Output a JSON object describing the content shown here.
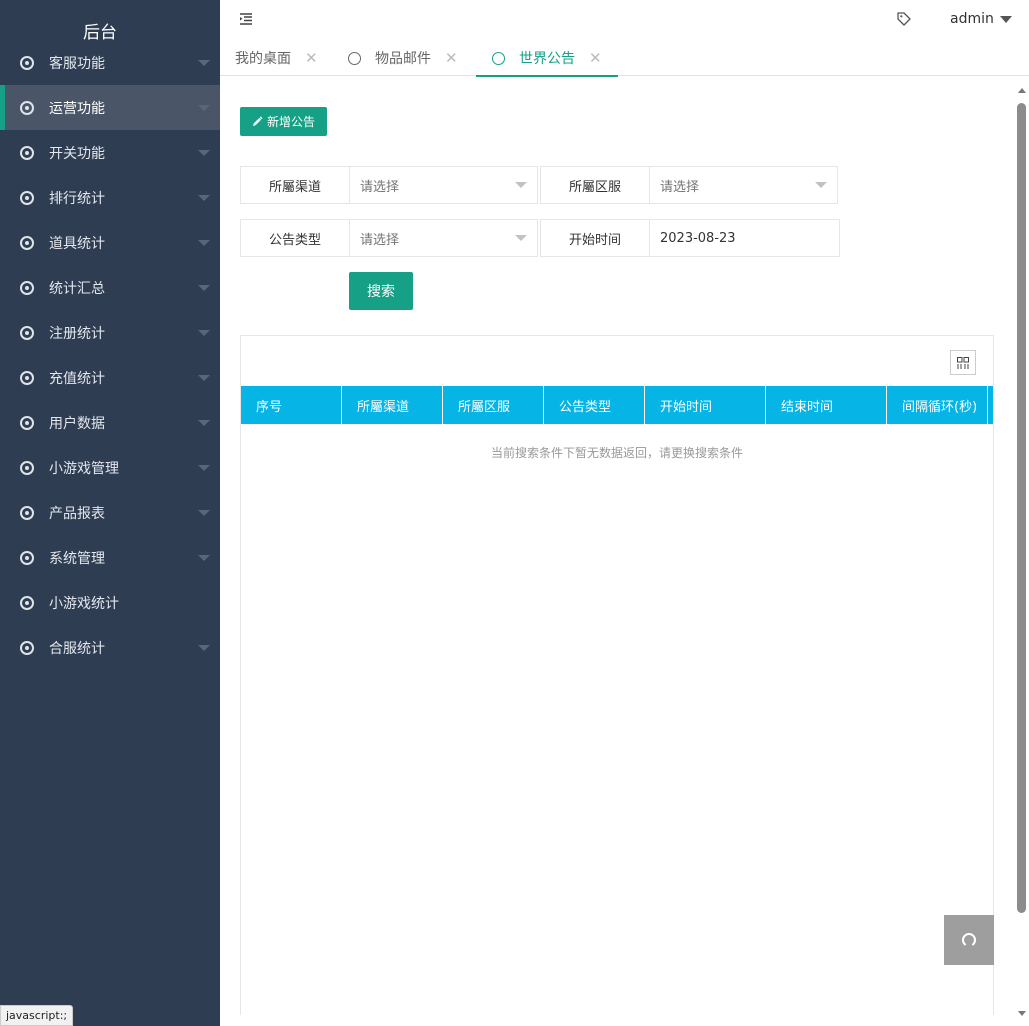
{
  "sidebar": {
    "title": "后台",
    "items": [
      {
        "label": "客服功能",
        "has_caret": true
      },
      {
        "label": "运营功能",
        "has_caret": true,
        "active": true
      },
      {
        "label": "开关功能",
        "has_caret": true
      },
      {
        "label": "排行统计",
        "has_caret": true
      },
      {
        "label": "道具统计",
        "has_caret": true
      },
      {
        "label": "统计汇总",
        "has_caret": true
      },
      {
        "label": "注册统计",
        "has_caret": true
      },
      {
        "label": "充值统计",
        "has_caret": true
      },
      {
        "label": "用户数据",
        "has_caret": true
      },
      {
        "label": "小游戏管理",
        "has_caret": true
      },
      {
        "label": "产品报表",
        "has_caret": true
      },
      {
        "label": "系统管理",
        "has_caret": true
      },
      {
        "label": "小游戏统计",
        "has_caret": false
      },
      {
        "label": "合服统计",
        "has_caret": true
      }
    ]
  },
  "header": {
    "user": "admin"
  },
  "tabs": [
    {
      "label": "我的桌面",
      "icon": "none"
    },
    {
      "label": "物品邮件",
      "icon": "circle-icon"
    },
    {
      "label": "世界公告",
      "icon": "circle-icon",
      "active": true
    }
  ],
  "toolbar": {
    "add_label": "新增公告",
    "search_label": "搜索"
  },
  "form": {
    "channel_label": "所屬渠道",
    "channel_placeholder": "请选择",
    "server_label": "所屬区服",
    "server_placeholder": "请选择",
    "type_label": "公告类型",
    "type_placeholder": "请选择",
    "start_label": "开始时间",
    "start_value": "2023-08-23"
  },
  "table": {
    "columns": [
      "序号",
      "所屬渠道",
      "所屬区服",
      "公告类型",
      "开始时间",
      "结束时间",
      "间隔循环(秒)"
    ],
    "empty_text": "当前搜索条件下暂无数据返回，请更换搜索条件"
  },
  "statusbar": {
    "text": "javascript:;"
  },
  "colors": {
    "sidebar_bg": "#2f3d52",
    "accent": "#16a085",
    "table_header": "#06b4e6"
  }
}
